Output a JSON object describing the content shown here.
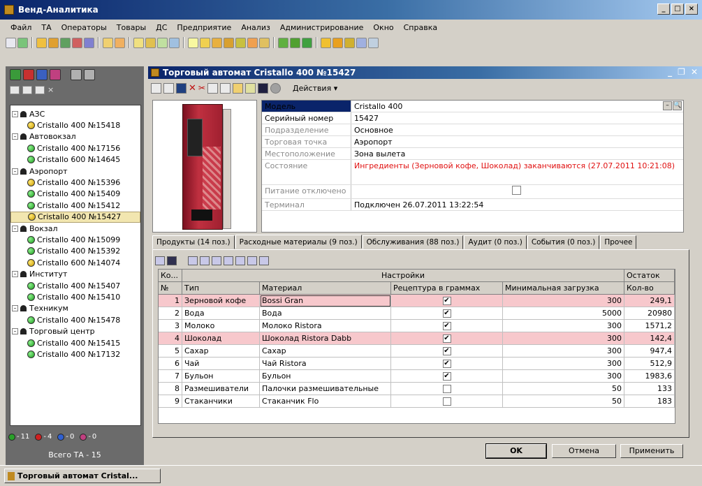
{
  "app": {
    "title": "Венд-Аналитика"
  },
  "menu": [
    "Файл",
    "ТА",
    "Операторы",
    "Товары",
    "ДС",
    "Предприятие",
    "Анализ",
    "Администрирование",
    "Окно",
    "Справка"
  ],
  "tree": [
    {
      "label": "АЗС",
      "children": [
        {
          "label": "Cristallo 400 №15418",
          "status": "warn"
        }
      ]
    },
    {
      "label": "Автовокзал",
      "children": [
        {
          "label": "Cristallo 400 №17156",
          "status": "ok"
        },
        {
          "label": "Cristallo 600 №14645",
          "status": "ok"
        }
      ]
    },
    {
      "label": "Аэропорт",
      "children": [
        {
          "label": "Cristallo 400 №15396",
          "status": "warn"
        },
        {
          "label": "Cristallo 400 №15409",
          "status": "ok"
        },
        {
          "label": "Cristallo 400 №15412",
          "status": "ok"
        },
        {
          "label": "Cristallo 400 №15427",
          "status": "warn",
          "selected": true
        }
      ]
    },
    {
      "label": "Вокзал",
      "children": [
        {
          "label": "Cristallo 400 №15099",
          "status": "ok"
        },
        {
          "label": "Cristallo 400 №15392",
          "status": "ok"
        },
        {
          "label": "Cristallo 600 №14074",
          "status": "warn"
        }
      ]
    },
    {
      "label": "Институт",
      "children": [
        {
          "label": "Cristallo 400 №15407",
          "status": "ok"
        },
        {
          "label": "Cristallo 400 №15410",
          "status": "ok"
        }
      ]
    },
    {
      "label": "Техникум",
      "children": [
        {
          "label": "Cristallo 400 №15478",
          "status": "ok"
        }
      ]
    },
    {
      "label": "Торговый центр",
      "children": [
        {
          "label": "Cristallo 400 №15415",
          "status": "ok"
        },
        {
          "label": "Cristallo 400 №17132",
          "status": "ok"
        }
      ]
    }
  ],
  "left_status": {
    "counts": [
      {
        "value": "11",
        "color": "#2aa02a"
      },
      {
        "value": "4",
        "color": "#d02020"
      },
      {
        "value": "0",
        "color": "#3060d0"
      },
      {
        "value": "0",
        "color": "#c04080"
      }
    ],
    "total": "Всего ТА - 15"
  },
  "child": {
    "title": "Торговый автомат Cristallo 400 №15427",
    "actions_label": "Действия"
  },
  "props": [
    {
      "label": "Модель",
      "value": "Cristallo 400"
    },
    {
      "label": "Серийный номер",
      "value": "15427"
    },
    {
      "label": "Подразделение",
      "value": "Основное"
    },
    {
      "label": "Торговая точка",
      "value": "Аэропорт"
    },
    {
      "label": "Местоположение",
      "value": "Зона вылета"
    },
    {
      "label": "Состояние",
      "value": "Ингредиенты (Зерновой кофе, Шоколад) заканчиваются (27.07.2011 10:21:08)"
    },
    {
      "label": "Питание отключено",
      "value": ""
    },
    {
      "label": "Терминал",
      "value": "Подключен 26.07.2011 13:22:54"
    }
  ],
  "tabs": [
    "Продукты (14 поз.)",
    "Расходные материалы (9 поз.)",
    "Обслуживания (88 поз.)",
    "Аудит (0 поз.)",
    "События (0 поз.)",
    "Прочее"
  ],
  "grid": {
    "group_headers": [
      "Ко...",
      "Настройки",
      "Остаток"
    ],
    "headers": [
      "№",
      "Тип",
      "Материал",
      "Рецептура в граммах",
      "Минимальная загрузка",
      "Кол-во"
    ],
    "rows": [
      {
        "n": "1",
        "type": "Зерновой кофе",
        "material": "Bossi Gran",
        "recipe": true,
        "min": "300",
        "qty": "249,1",
        "alert": true
      },
      {
        "n": "2",
        "type": "Вода",
        "material": "Вода",
        "recipe": true,
        "min": "5000",
        "qty": "20980",
        "alert": false
      },
      {
        "n": "3",
        "type": "Молоко",
        "material": "Молоко Ristora",
        "recipe": true,
        "min": "300",
        "qty": "1571,2",
        "alert": false
      },
      {
        "n": "4",
        "type": "Шоколад",
        "material": "Шоколад Ristora Dabb",
        "recipe": true,
        "min": "300",
        "qty": "142,4",
        "alert": true
      },
      {
        "n": "5",
        "type": "Сахар",
        "material": "Сахар",
        "recipe": true,
        "min": "300",
        "qty": "947,4",
        "alert": false
      },
      {
        "n": "6",
        "type": "Чай",
        "material": "Чай Ristora",
        "recipe": true,
        "min": "300",
        "qty": "512,9",
        "alert": false
      },
      {
        "n": "7",
        "type": "Бульон",
        "material": "Бульон",
        "recipe": true,
        "min": "300",
        "qty": "1983,6",
        "alert": false
      },
      {
        "n": "8",
        "type": "Размешиватели",
        "material": "Палочки размешивательные",
        "recipe": false,
        "min": "50",
        "qty": "133",
        "alert": false
      },
      {
        "n": "9",
        "type": "Стаканчики",
        "material": "Стаканчик Flo",
        "recipe": false,
        "min": "50",
        "qty": "183",
        "alert": false
      }
    ]
  },
  "buttons": {
    "ok": "OK",
    "cancel": "Отмена",
    "apply": "Применить"
  },
  "taskbar": {
    "item": "Торговый автомат Cristal..."
  }
}
